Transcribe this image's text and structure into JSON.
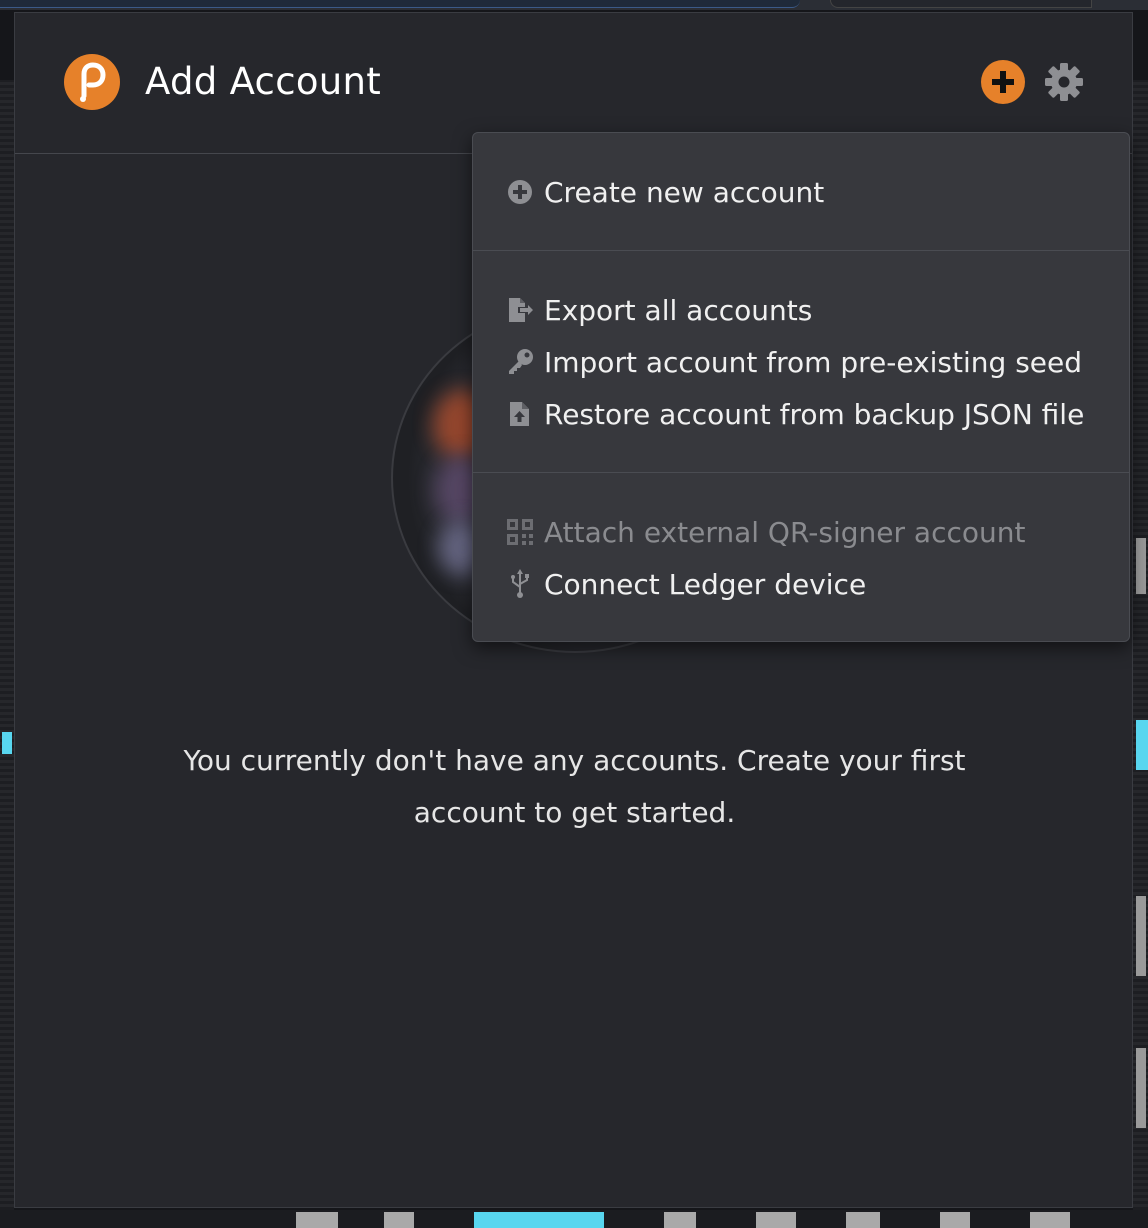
{
  "header": {
    "title": "Add Account"
  },
  "menu": {
    "create": {
      "label": "Create new account",
      "icon": "plus-circle-icon"
    },
    "export": {
      "label": "Export all accounts",
      "icon": "file-export-icon"
    },
    "import_seed": {
      "label": "Import account from pre-existing seed",
      "icon": "key-icon"
    },
    "restore_json": {
      "label": "Restore account from backup JSON file",
      "icon": "file-upload-icon"
    },
    "attach_qr": {
      "label": "Attach external QR-signer account",
      "icon": "qrcode-icon",
      "disabled": true
    },
    "ledger": {
      "label": "Connect Ledger device",
      "icon": "usb-icon"
    }
  },
  "empty_state": {
    "line1": "You currently don't have any accounts. Create your first",
    "line2": "account to get started."
  },
  "colors": {
    "accent": "#e6812a",
    "panel": "#26272c",
    "menu": "#37383d",
    "text": "#f0f0f0",
    "disabled_text": "#8a8b8f"
  }
}
